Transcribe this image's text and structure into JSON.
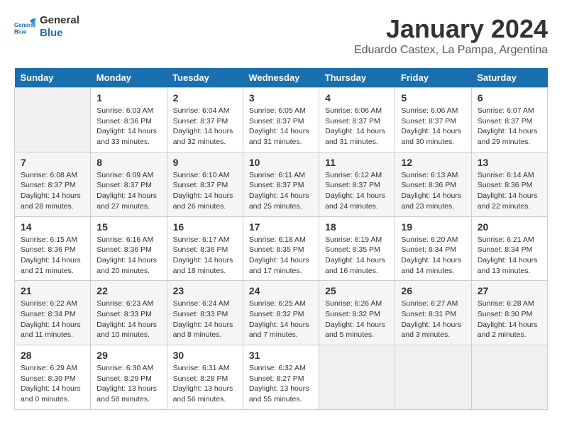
{
  "header": {
    "logo_line1": "General",
    "logo_line2": "Blue",
    "title": "January 2024",
    "subtitle": "Eduardo Castex, La Pampa, Argentina"
  },
  "weekdays": [
    "Sunday",
    "Monday",
    "Tuesday",
    "Wednesday",
    "Thursday",
    "Friday",
    "Saturday"
  ],
  "weeks": [
    [
      {
        "day": "",
        "info": ""
      },
      {
        "day": "1",
        "info": "Sunrise: 6:03 AM\nSunset: 8:36 PM\nDaylight: 14 hours\nand 33 minutes."
      },
      {
        "day": "2",
        "info": "Sunrise: 6:04 AM\nSunset: 8:37 PM\nDaylight: 14 hours\nand 32 minutes."
      },
      {
        "day": "3",
        "info": "Sunrise: 6:05 AM\nSunset: 8:37 PM\nDaylight: 14 hours\nand 31 minutes."
      },
      {
        "day": "4",
        "info": "Sunrise: 6:06 AM\nSunset: 8:37 PM\nDaylight: 14 hours\nand 31 minutes."
      },
      {
        "day": "5",
        "info": "Sunrise: 6:06 AM\nSunset: 8:37 PM\nDaylight: 14 hours\nand 30 minutes."
      },
      {
        "day": "6",
        "info": "Sunrise: 6:07 AM\nSunset: 8:37 PM\nDaylight: 14 hours\nand 29 minutes."
      }
    ],
    [
      {
        "day": "7",
        "info": "Sunrise: 6:08 AM\nSunset: 8:37 PM\nDaylight: 14 hours\nand 28 minutes."
      },
      {
        "day": "8",
        "info": "Sunrise: 6:09 AM\nSunset: 8:37 PM\nDaylight: 14 hours\nand 27 minutes."
      },
      {
        "day": "9",
        "info": "Sunrise: 6:10 AM\nSunset: 8:37 PM\nDaylight: 14 hours\nand 26 minutes."
      },
      {
        "day": "10",
        "info": "Sunrise: 6:11 AM\nSunset: 8:37 PM\nDaylight: 14 hours\nand 25 minutes."
      },
      {
        "day": "11",
        "info": "Sunrise: 6:12 AM\nSunset: 8:37 PM\nDaylight: 14 hours\nand 24 minutes."
      },
      {
        "day": "12",
        "info": "Sunrise: 6:13 AM\nSunset: 8:36 PM\nDaylight: 14 hours\nand 23 minutes."
      },
      {
        "day": "13",
        "info": "Sunrise: 6:14 AM\nSunset: 8:36 PM\nDaylight: 14 hours\nand 22 minutes."
      }
    ],
    [
      {
        "day": "14",
        "info": "Sunrise: 6:15 AM\nSunset: 8:36 PM\nDaylight: 14 hours\nand 21 minutes."
      },
      {
        "day": "15",
        "info": "Sunrise: 6:16 AM\nSunset: 8:36 PM\nDaylight: 14 hours\nand 20 minutes."
      },
      {
        "day": "16",
        "info": "Sunrise: 6:17 AM\nSunset: 8:36 PM\nDaylight: 14 hours\nand 18 minutes."
      },
      {
        "day": "17",
        "info": "Sunrise: 6:18 AM\nSunset: 8:35 PM\nDaylight: 14 hours\nand 17 minutes."
      },
      {
        "day": "18",
        "info": "Sunrise: 6:19 AM\nSunset: 8:35 PM\nDaylight: 14 hours\nand 16 minutes."
      },
      {
        "day": "19",
        "info": "Sunrise: 6:20 AM\nSunset: 8:34 PM\nDaylight: 14 hours\nand 14 minutes."
      },
      {
        "day": "20",
        "info": "Sunrise: 6:21 AM\nSunset: 8:34 PM\nDaylight: 14 hours\nand 13 minutes."
      }
    ],
    [
      {
        "day": "21",
        "info": "Sunrise: 6:22 AM\nSunset: 8:34 PM\nDaylight: 14 hours\nand 11 minutes."
      },
      {
        "day": "22",
        "info": "Sunrise: 6:23 AM\nSunset: 8:33 PM\nDaylight: 14 hours\nand 10 minutes."
      },
      {
        "day": "23",
        "info": "Sunrise: 6:24 AM\nSunset: 8:33 PM\nDaylight: 14 hours\nand 8 minutes."
      },
      {
        "day": "24",
        "info": "Sunrise: 6:25 AM\nSunset: 8:32 PM\nDaylight: 14 hours\nand 7 minutes."
      },
      {
        "day": "25",
        "info": "Sunrise: 6:26 AM\nSunset: 8:32 PM\nDaylight: 14 hours\nand 5 minutes."
      },
      {
        "day": "26",
        "info": "Sunrise: 6:27 AM\nSunset: 8:31 PM\nDaylight: 14 hours\nand 3 minutes."
      },
      {
        "day": "27",
        "info": "Sunrise: 6:28 AM\nSunset: 8:30 PM\nDaylight: 14 hours\nand 2 minutes."
      }
    ],
    [
      {
        "day": "28",
        "info": "Sunrise: 6:29 AM\nSunset: 8:30 PM\nDaylight: 14 hours\nand 0 minutes."
      },
      {
        "day": "29",
        "info": "Sunrise: 6:30 AM\nSunset: 8:29 PM\nDaylight: 13 hours\nand 58 minutes."
      },
      {
        "day": "30",
        "info": "Sunrise: 6:31 AM\nSunset: 8:28 PM\nDaylight: 13 hours\nand 56 minutes."
      },
      {
        "day": "31",
        "info": "Sunrise: 6:32 AM\nSunset: 8:27 PM\nDaylight: 13 hours\nand 55 minutes."
      },
      {
        "day": "",
        "info": ""
      },
      {
        "day": "",
        "info": ""
      },
      {
        "day": "",
        "info": ""
      }
    ]
  ]
}
